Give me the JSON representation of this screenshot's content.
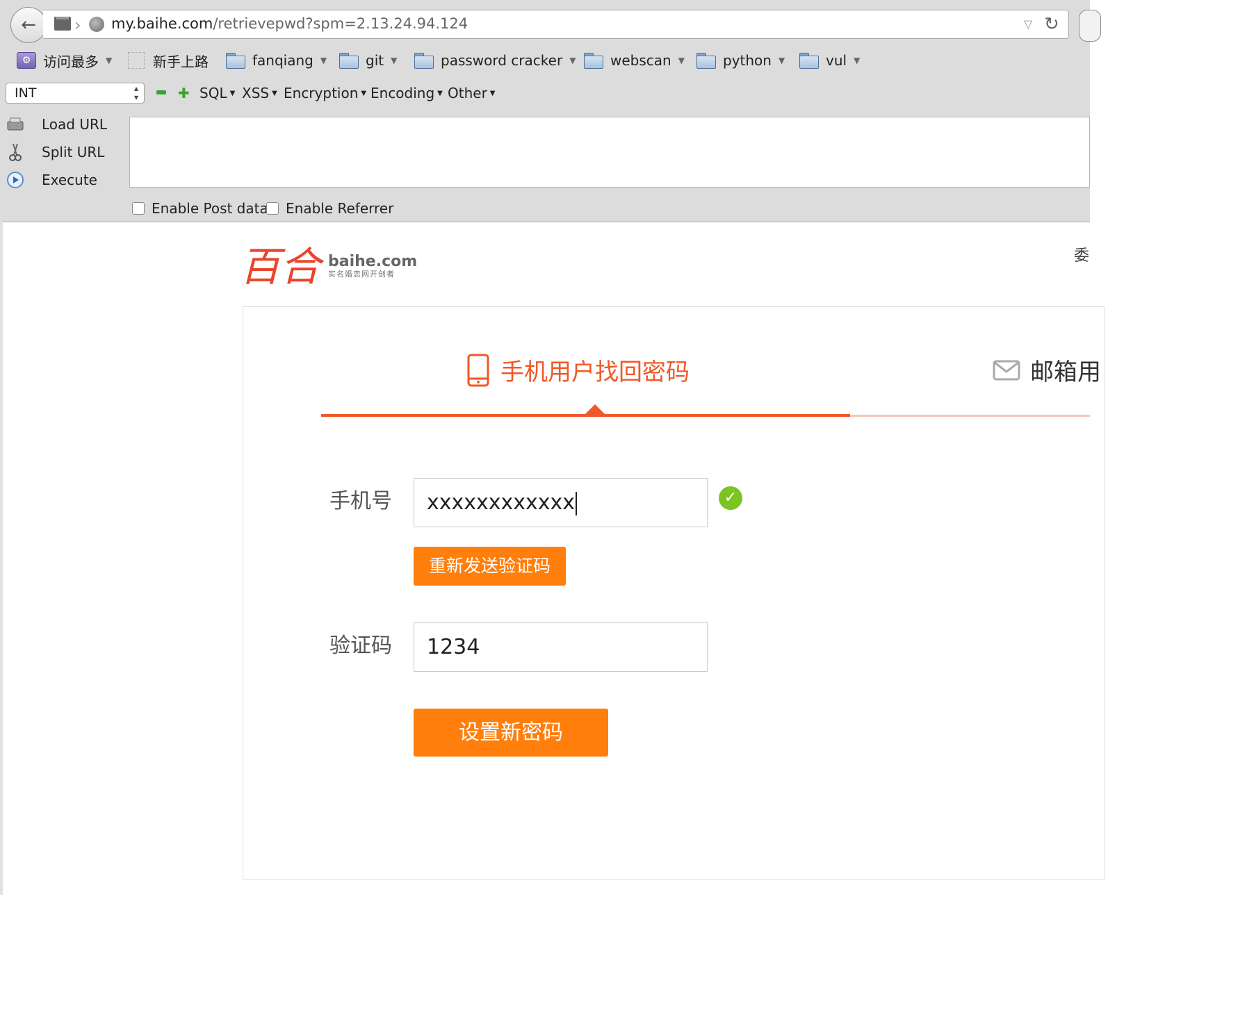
{
  "browser": {
    "url_host": "my.baihe.com",
    "url_path": "/retrievepwd?spm=2.13.24.94.124"
  },
  "bookmarks": [
    {
      "label": "访问最多"
    },
    {
      "label": "新手上路"
    },
    {
      "label": "fanqiang"
    },
    {
      "label": "git"
    },
    {
      "label": "password cracker"
    },
    {
      "label": "webscan"
    },
    {
      "label": "python"
    },
    {
      "label": "vul"
    }
  ],
  "hackbar": {
    "select_value": "INT",
    "menus": [
      "SQL",
      "XSS",
      "Encryption",
      "Encoding",
      "Other"
    ],
    "load_url": "Load URL",
    "split_url": "Split URL",
    "execute": "Execute",
    "enable_post": "Enable Post data",
    "enable_referrer": "Enable Referrer"
  },
  "page": {
    "logo_text": "baihe.com",
    "logo_cn": "百合",
    "logo_sub": "实名婚恋网开创者",
    "top_right_partial": "委",
    "tab_phone": "手机用户找回密码",
    "tab_email": "邮箱用",
    "phone_label": "手机号",
    "phone_value": "xxxxxxxxxxxx",
    "resend_button": "重新发送验证码",
    "code_label": "验证码",
    "code_value": "1234",
    "submit_button": "设置新密码",
    "accent_color": "#ef5828",
    "button_color": "#ff7e0c"
  }
}
